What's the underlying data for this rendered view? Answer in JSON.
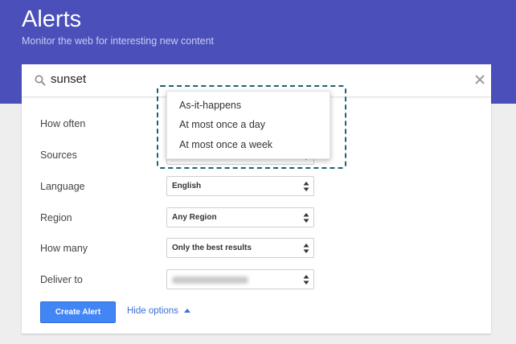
{
  "header": {
    "title": "Alerts",
    "subtitle": "Monitor the web for interesting new content"
  },
  "search": {
    "value": "sunset",
    "icon": "search-icon",
    "clear_icon": "close-icon"
  },
  "options": {
    "how_often_label": "How often",
    "sources_label": "Sources",
    "language_label": "Language",
    "language_value": "English",
    "region_label": "Region",
    "region_value": "Any Region",
    "how_many_label": "How many",
    "how_many_value": "Only the best results",
    "deliver_to_label": "Deliver to"
  },
  "dropdown": {
    "items": [
      "As-it-happens",
      "At most once a day",
      "At most once a week"
    ]
  },
  "actions": {
    "create_label": "Create Alert",
    "hide_options_label": "Hide options"
  },
  "colors": {
    "header_bg": "#4a4fba",
    "primary_button": "#4285f4",
    "link": "#3b6fd6",
    "highlight_dashed": "#1f5f78"
  }
}
